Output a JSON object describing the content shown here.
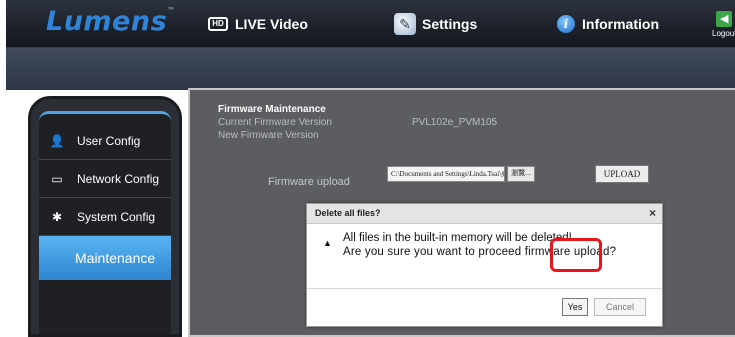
{
  "nav": {
    "logo": "Lumens",
    "logo_tm": "™",
    "live_video": "LIVE Video",
    "live_icon_text": "HD",
    "settings": "Settings",
    "information": "Information",
    "logout": "Logout"
  },
  "sidebar": {
    "items": [
      {
        "label": "User Config",
        "icon": "user-icon"
      },
      {
        "label": "Network Config",
        "icon": "monitor-icon"
      },
      {
        "label": "System Config",
        "icon": "gear-icon"
      },
      {
        "label": "Maintenance",
        "icon": "",
        "active": true
      }
    ]
  },
  "firmware": {
    "title": "Firmware Maintenance",
    "current_label": "Current Firmware Version",
    "new_label": "New Firmware Version",
    "current_version": "PVL102e_PVM105",
    "upload_label": "Firmware upload",
    "file_path": "C:\\Documents and Settings\\Linda.Tsai\\桌面\\",
    "browse_label": "瀏覽...",
    "upload_button": "UPLOAD"
  },
  "dialog": {
    "title": "Delete all files?",
    "close": "×",
    "warn_icon": "▲",
    "line1": "All files in the built-in memory will be deleted!",
    "line2": "Are you sure you want to proceed firmware upload?",
    "yes": "Yes",
    "cancel": "Cancel"
  },
  "colors": {
    "accent": "#2f84d8",
    "highlight": "#e8161c",
    "active_menu": "#3d98e0"
  }
}
